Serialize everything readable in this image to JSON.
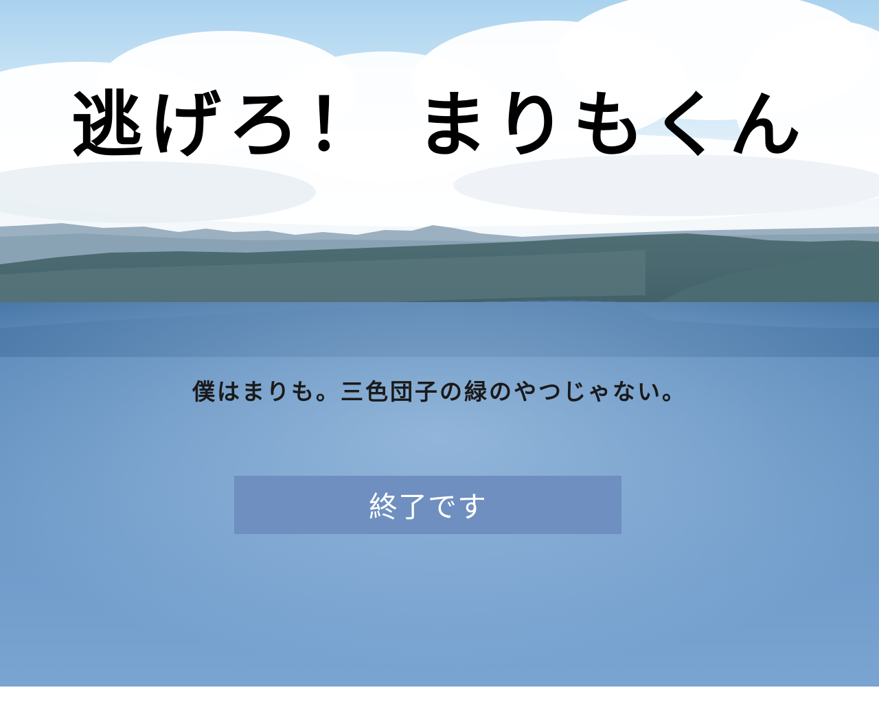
{
  "game": {
    "title": "逃げろ！ まりもくん",
    "message": "僕はまりも。三色団子の緑のやつじゃない。",
    "end_button_label": "終了です"
  },
  "colors": {
    "button_background": "#6e8fbf",
    "button_text": "#ffffff",
    "title_text": "#000000",
    "lake_water": "#4f7fae",
    "sky": "#a9d2ef"
  }
}
